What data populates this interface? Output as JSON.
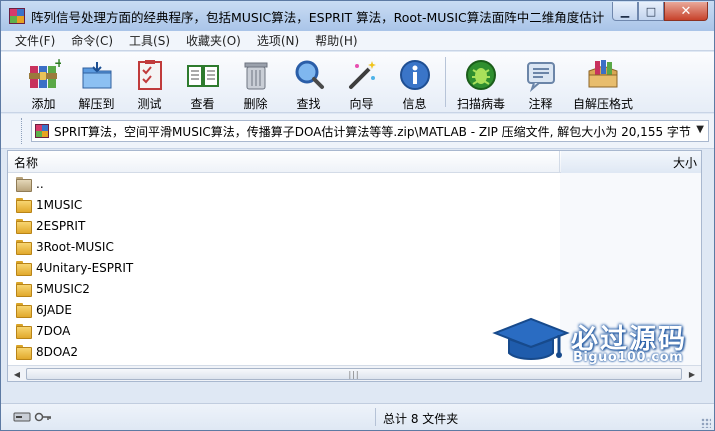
{
  "window": {
    "title": "阵列信号处理方面的经典程序，包括MUSIC算法，ESPRIT 算法，Root-MUSIC算法面阵中二维角度估计 ..."
  },
  "menu": [
    "文件(F)",
    "命令(C)",
    "工具(S)",
    "收藏夹(O)",
    "选项(N)",
    "帮助(H)"
  ],
  "toolbar": {
    "add": "添加",
    "extract": "解压到",
    "test": "测试",
    "view": "查看",
    "delete": "删除",
    "find": "查找",
    "wizard": "向导",
    "info": "信息",
    "scan": "扫描病毒",
    "comment": "注释",
    "sfx": "自解压格式"
  },
  "address": {
    "path": "SPRIT算法，空间平滑MUSIC算法，传播算子DOA估计算法等等.zip\\MATLAB - ZIP 压缩文件, 解包大小为 20,155 字节"
  },
  "list": {
    "col_name": "名称",
    "col_size": "大小",
    "items": [
      "..",
      "1MUSIC",
      "2ESPRIT",
      "3Root-MUSIC",
      "4Unitary-ESPRIT",
      "5MUSIC2",
      "6JADE",
      "7DOA",
      "8DOA2"
    ]
  },
  "watermark": {
    "title": "必过源码",
    "url": "Biguo100.com"
  },
  "status": {
    "summary": "总计 8 文件夹"
  },
  "colors": {
    "accent": "#245da8",
    "window_bg": "#dfe8f4",
    "close": "#c7422b"
  }
}
